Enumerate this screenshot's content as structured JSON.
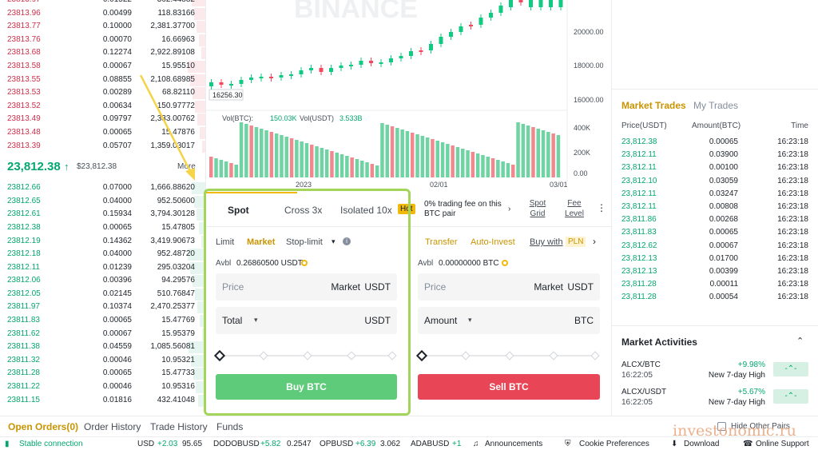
{
  "orderbook": {
    "asks": [
      {
        "price": "23813.97",
        "amount": "0.01522",
        "total": "362.44882"
      },
      {
        "price": "23813.96",
        "amount": "0.00499",
        "total": "118.83166"
      },
      {
        "price": "23813.77",
        "amount": "0.10000",
        "total": "2,381.37700"
      },
      {
        "price": "23813.76",
        "amount": "0.00070",
        "total": "16.66963"
      },
      {
        "price": "23813.68",
        "amount": "0.12274",
        "total": "2,922.89108"
      },
      {
        "price": "23813.58",
        "amount": "0.00067",
        "total": "15.95510"
      },
      {
        "price": "23813.55",
        "amount": "0.08855",
        "total": "2,108.68985"
      },
      {
        "price": "23813.53",
        "amount": "0.00289",
        "total": "68.82110"
      },
      {
        "price": "23813.52",
        "amount": "0.00634",
        "total": "150.97772"
      },
      {
        "price": "23813.49",
        "amount": "0.09797",
        "total": "2,333.00762"
      },
      {
        "price": "23813.48",
        "amount": "0.00065",
        "total": "15.47876"
      },
      {
        "price": "23813.39",
        "amount": "0.05707",
        "total": "1,359.03017"
      }
    ],
    "last_price": "23,812.38",
    "last_price_usd": "$23,812.38",
    "more_label": "More",
    "bids": [
      {
        "price": "23812.66",
        "amount": "0.07000",
        "total": "1,666.88620"
      },
      {
        "price": "23812.65",
        "amount": "0.04000",
        "total": "952.50600"
      },
      {
        "price": "23812.61",
        "amount": "0.15934",
        "total": "3,794.30128"
      },
      {
        "price": "23812.38",
        "amount": "0.00065",
        "total": "15.47805"
      },
      {
        "price": "23812.19",
        "amount": "0.14362",
        "total": "3,419.90673"
      },
      {
        "price": "23812.18",
        "amount": "0.04000",
        "total": "952.48720"
      },
      {
        "price": "23812.11",
        "amount": "0.01239",
        "total": "295.03204"
      },
      {
        "price": "23812.06",
        "amount": "0.00396",
        "total": "94.29576"
      },
      {
        "price": "23812.05",
        "amount": "0.02145",
        "total": "510.76847"
      },
      {
        "price": "23811.97",
        "amount": "0.10374",
        "total": "2,470.25377"
      },
      {
        "price": "23811.83",
        "amount": "0.00065",
        "total": "15.47769"
      },
      {
        "price": "23811.62",
        "amount": "0.00067",
        "total": "15.95379"
      },
      {
        "price": "23811.38",
        "amount": "0.04559",
        "total": "1,085.56081"
      },
      {
        "price": "23811.32",
        "amount": "0.00046",
        "total": "10.95321"
      },
      {
        "price": "23811.28",
        "amount": "0.00065",
        "total": "15.47733"
      },
      {
        "price": "23811.22",
        "amount": "0.00046",
        "total": "10.95316"
      },
      {
        "price": "23811.15",
        "amount": "0.01816",
        "total": "432.41048"
      }
    ]
  },
  "chart": {
    "watermark": "BINANCE",
    "y_ticks": [
      "20000.00",
      "18000.00",
      "16000.00"
    ],
    "low_label": "16256.30",
    "vol_label": "Vol(BTC):",
    "vol_btc": "150.03K",
    "vol_usdt_label": "Vol(USDT)",
    "vol_usdt": "3.533B",
    "vol_ticks": [
      "400K",
      "200K",
      "0.00"
    ],
    "x_ticks": [
      "2023",
      "02/01",
      "03/01"
    ]
  },
  "trade": {
    "tabs": [
      "Spot",
      "Cross 3x",
      "Isolated 10x"
    ],
    "hot": "Hot",
    "promo": "0% trading fee on this BTC pair",
    "spot_grid": "Spot Grid",
    "fee_level": "Fee Level",
    "order_types": [
      "Limit",
      "Market",
      "Stop-limit"
    ],
    "transfer": "Transfer",
    "auto_invest": "Auto-Invest",
    "buy_with": "Buy with",
    "pln": "PLN",
    "buy_avbl_label": "Avbl",
    "buy_avbl": "0.26860500 USDT",
    "sell_avbl_label": "Avbl",
    "sell_avbl": "0.00000000 BTC",
    "price_label": "Price",
    "market_label": "Market",
    "usdt": "USDT",
    "total_label": "Total",
    "amount_label": "Amount",
    "btc": "BTC",
    "buy_btn": "Buy BTC",
    "sell_btn": "Sell BTC",
    "colors": {
      "buy": "#5ecb7b",
      "sell": "#e84556",
      "accent": "#f0b90b",
      "highlight": "#a2d55a"
    }
  },
  "market_trades": {
    "tabs": [
      "Market Trades",
      "My Trades"
    ],
    "headers": [
      "Price(USDT)",
      "Amount(BTC)",
      "Time"
    ],
    "rows": [
      {
        "price": "23,812.38",
        "amount": "0.00065",
        "time": "16:23:18"
      },
      {
        "price": "23,812.11",
        "amount": "0.03900",
        "time": "16:23:18"
      },
      {
        "price": "23,812.11",
        "amount": "0.00100",
        "time": "16:23:18"
      },
      {
        "price": "23,812.10",
        "amount": "0.03059",
        "time": "16:23:18"
      },
      {
        "price": "23,812.11",
        "amount": "0.03247",
        "time": "16:23:18"
      },
      {
        "price": "23,812.11",
        "amount": "0.00808",
        "time": "16:23:18"
      },
      {
        "price": "23,811.86",
        "amount": "0.00268",
        "time": "16:23:18"
      },
      {
        "price": "23,811.83",
        "amount": "0.00065",
        "time": "16:23:18"
      },
      {
        "price": "23,812.62",
        "amount": "0.00067",
        "time": "16:23:18"
      },
      {
        "price": "23,812.13",
        "amount": "0.01700",
        "time": "16:23:18"
      },
      {
        "price": "23,812.13",
        "amount": "0.00399",
        "time": "16:23:18"
      },
      {
        "price": "23,811.28",
        "amount": "0.00011",
        "time": "16:23:18"
      },
      {
        "price": "23,811.28",
        "amount": "0.00054",
        "time": "16:23:18"
      }
    ]
  },
  "market_activities": {
    "title": "Market Activities",
    "items": [
      {
        "pair": "ALCX/BTC",
        "time": "16:22:05",
        "change": "+9.98%",
        "desc": "New 7-day High"
      },
      {
        "pair": "ALCX/USDT",
        "time": "16:22:05",
        "change": "+5.67%",
        "desc": "New 7-day High"
      }
    ]
  },
  "bottom_tabs": [
    "Open Orders(0)",
    "Order History",
    "Trade History",
    "Funds"
  ],
  "hide_other_pairs": "Hide Other Pairs",
  "status": {
    "connection": "Stable connection",
    "ticker": [
      {
        "sym": "USD",
        "chg": "+2.03",
        "price": "95.65"
      },
      {
        "sym": "DODOBUSD",
        "chg": "+5.82",
        "price": "0.2547"
      },
      {
        "sym": "OPBUSD",
        "chg": "+6.39",
        "price": "3.062"
      },
      {
        "sym": "ADABUSD",
        "chg": "+1",
        "price": ""
      }
    ],
    "announcements": "Announcements",
    "cookie": "Cookie Preferences",
    "download": "Download",
    "support": "Online Support"
  },
  "watermark_site": "investonomic.ru"
}
